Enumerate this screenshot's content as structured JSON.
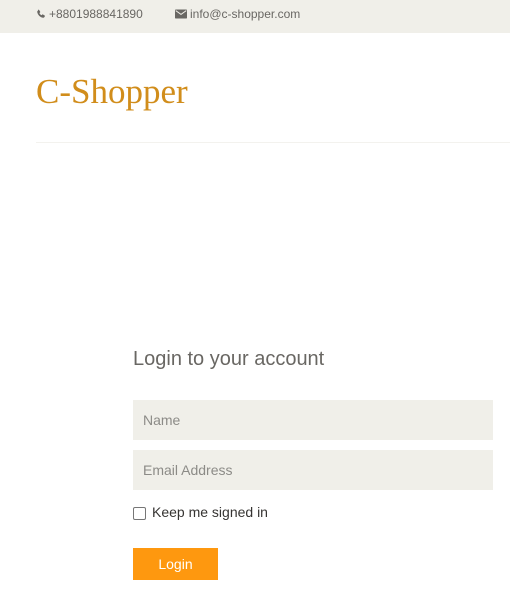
{
  "header": {
    "phone": "+8801988841890",
    "email": "info@c-shopper.com",
    "phone_icon": "phone-icon",
    "email_icon": "envelope-icon"
  },
  "brand": {
    "logo_text": "C-Shopper",
    "color": "#d18d1b"
  },
  "login_form": {
    "title": "Login to your account",
    "name_placeholder": "Name",
    "email_placeholder": "Email Address",
    "remember_label": "Keep me signed in",
    "remember_checked": false,
    "submit_label": "Login",
    "accent_color": "#fe980f"
  }
}
